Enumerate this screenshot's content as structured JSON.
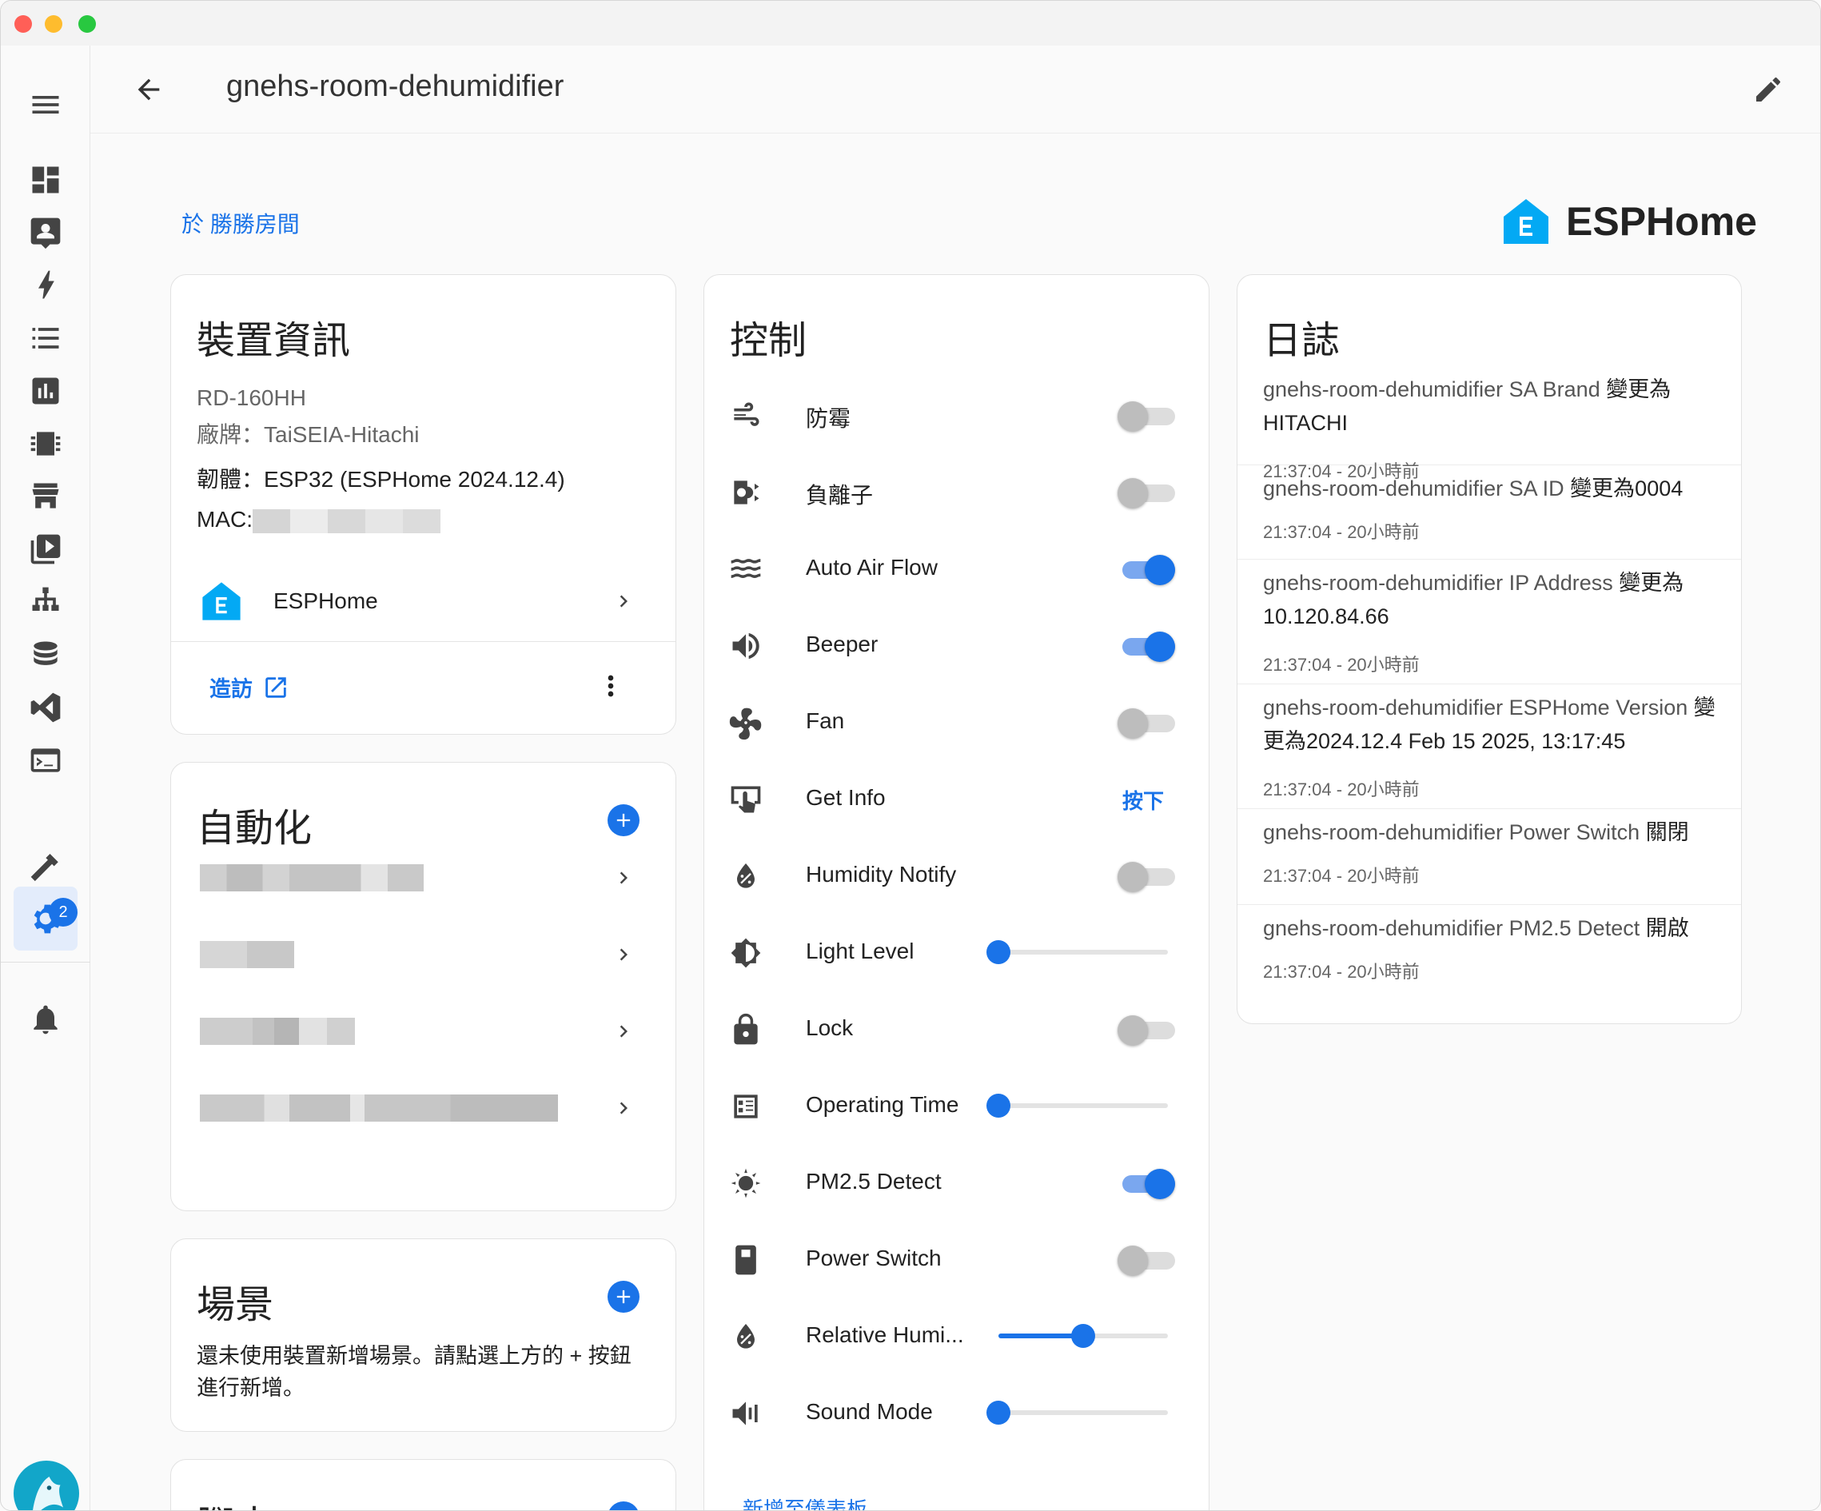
{
  "window": {
    "title": "gnehs-room-dehumidifier"
  },
  "header": {
    "title": "gnehs-room-dehumidifier"
  },
  "area_link": "於 勝勝房間",
  "brand": {
    "name": "ESPHome",
    "color": "#03a9f4"
  },
  "device_info": {
    "title": "裝置資訊",
    "model": "RD-160HH",
    "manufacturer": "廠牌：TaiSEIA-Hitachi",
    "firmware": "韌體：ESP32 (ESPHome 2024.12.4)",
    "mac_label": "MAC:",
    "integration": "ESPHome",
    "visit": "造訪"
  },
  "automation": {
    "title": "自動化"
  },
  "scene": {
    "title": "場景",
    "empty_text": "還未使用裝置新增場景。請點選上方的 + 按鈕進行新增。"
  },
  "script_card": {
    "title": "腳本"
  },
  "controls": {
    "title": "控制",
    "items": [
      {
        "label": "防霉",
        "icon": "fan-wind-icon",
        "type": "switch",
        "on": false
      },
      {
        "label": "負離子",
        "icon": "ion-icon",
        "type": "switch",
        "on": false
      },
      {
        "label": "Auto Air Flow",
        "icon": "waves-icon",
        "type": "switch",
        "on": true
      },
      {
        "label": "Beeper",
        "icon": "speaker-icon",
        "type": "switch",
        "on": true
      },
      {
        "label": "Fan",
        "icon": "fan-icon",
        "type": "switch",
        "on": false
      },
      {
        "label": "Get Info",
        "icon": "tap-icon",
        "type": "button",
        "button_label": "按下"
      },
      {
        "label": "Humidity Notify",
        "icon": "water-percent-icon",
        "type": "switch",
        "on": false
      },
      {
        "label": "Light Level",
        "icon": "brightness-icon",
        "type": "slider",
        "value": 0.0
      },
      {
        "label": "Lock",
        "icon": "lock-icon",
        "type": "switch",
        "on": false
      },
      {
        "label": "Operating Time",
        "icon": "counter-icon",
        "type": "slider",
        "value": 0.0
      },
      {
        "label": "PM2.5 Detect",
        "icon": "virus-icon",
        "type": "switch",
        "on": true
      },
      {
        "label": "Power Switch",
        "icon": "power-switch-icon",
        "type": "switch",
        "on": false
      },
      {
        "label": "Relative Humi...",
        "icon": "water-percent-icon",
        "type": "slider",
        "value": 0.5
      },
      {
        "label": "Sound Mode",
        "icon": "volume-icon",
        "type": "slider",
        "value": 0.0
      }
    ],
    "footer_link": "新增至儀表板"
  },
  "logbook": {
    "title": "日誌",
    "entries": [
      {
        "prefix": "gnehs-room-dehumidifier SA Brand ",
        "action": "變更為 HITACHI",
        "time": "21:37:04 - 20小時前"
      },
      {
        "prefix": "gnehs-room-dehumidifier SA ID ",
        "action": "變更為0004",
        "time": "21:37:04 - 20小時前"
      },
      {
        "prefix": "gnehs-room-dehumidifier IP Address ",
        "action": "變更為 10.120.84.66",
        "time": "21:37:04 - 20小時前"
      },
      {
        "prefix": "gnehs-room-dehumidifier ESPHome Version ",
        "action": "變更為2024.12.4 Feb 15 2025, 13:17:45",
        "time": "21:37:04 - 20小時前"
      },
      {
        "prefix": "gnehs-room-dehumidifier Power Switch ",
        "action": "關閉",
        "time": "21:37:04 - 20小時前"
      },
      {
        "prefix": "gnehs-room-dehumidifier PM2.5 Detect ",
        "action": "開啟",
        "time": "21:37:04 - 20小時前"
      }
    ]
  },
  "sidebar": {
    "notifications_badge": "2"
  },
  "colors": {
    "accent": "#1a73e8",
    "switch_off": "#bdbdbd"
  }
}
